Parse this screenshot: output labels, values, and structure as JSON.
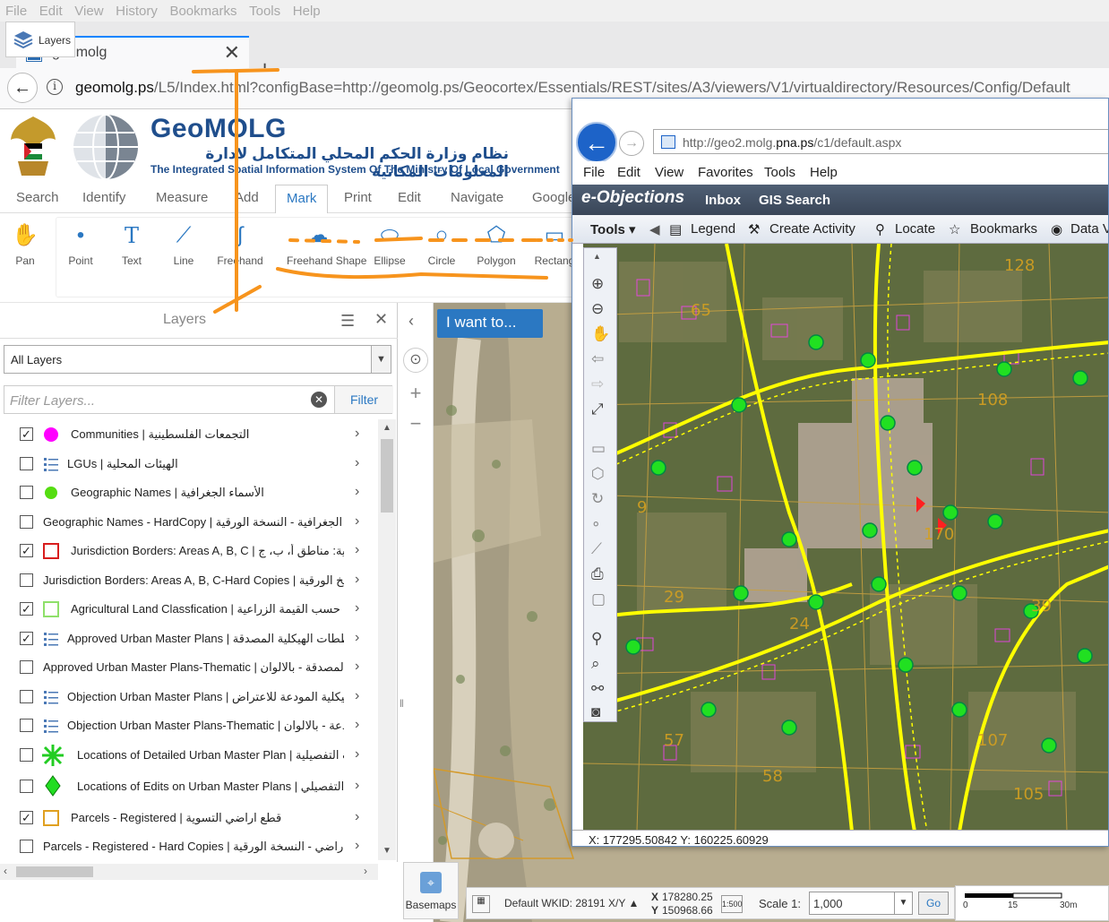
{
  "firefox": {
    "menu": [
      "File",
      "Edit",
      "View",
      "History",
      "Bookmarks",
      "Tools",
      "Help"
    ],
    "tab_title": "geomolg",
    "url_host": "geomolg.ps",
    "url_rest": "/L5/Index.html?configBase=http://geomolg.ps/Geocortex/Essentials/REST/sites/A3/viewers/V1/virtualdirectory/Resources/Config/Default"
  },
  "header": {
    "title": "GeoMOLG",
    "arabic": "نظام وزارة الحكم المحلي المتكامل لادارة المعلومات المكانية",
    "english": "The Integrated Spatial Information System Of The Ministry Of Local Government"
  },
  "menu_tabs": [
    "Search",
    "Identify",
    "Measure",
    "Add",
    "Mark",
    "Print",
    "Edit",
    "Navigate",
    "Google"
  ],
  "active_tab": "Mark",
  "tools": [
    {
      "label": "Pan",
      "icon": "hand-icon",
      "glyph": "✋"
    },
    {
      "label": "Point",
      "icon": "point-icon",
      "glyph": "•"
    },
    {
      "label": "Text",
      "icon": "text-icon",
      "glyph": "T"
    },
    {
      "label": "Line",
      "icon": "line-icon",
      "glyph": "⟋"
    },
    {
      "label": "Freehand",
      "icon": "freehand-icon",
      "glyph": "∫"
    },
    {
      "label": "Freehand Shape",
      "icon": "freehand-shape-icon",
      "glyph": "☁"
    },
    {
      "label": "Ellipse",
      "icon": "ellipse-icon",
      "glyph": "⬭"
    },
    {
      "label": "Circle",
      "icon": "circle-icon",
      "glyph": "○"
    },
    {
      "label": "Polygon",
      "icon": "polygon-icon",
      "glyph": "⬠"
    },
    {
      "label": "Rectang",
      "icon": "rectangle-icon",
      "glyph": "▭"
    }
  ],
  "layers_panel": {
    "title": "Layers",
    "select_value": "All Layers",
    "filter_placeholder": "Filter Layers...",
    "filter_button": "Filter",
    "items": [
      {
        "checked": true,
        "sym": "magenta-dot",
        "text": "Communities | التجمعات الفلسطينية"
      },
      {
        "checked": false,
        "sym": "list",
        "text": "LGUs | الهيئات المحلية"
      },
      {
        "checked": false,
        "sym": "green-dot",
        "text": "Geographic Names | الأسماء الجغرافية"
      },
      {
        "checked": false,
        "sym": "none",
        "text": "Geographic Names - HardCopy | الأسماء الجغرافية - النسخة الورقية"
      },
      {
        "checked": true,
        "sym": "red-square",
        "text": "Jurisdiction Borders: Areas A, B, C | حدود الولاية: مناطق أ، ب، ج"
      },
      {
        "checked": false,
        "sym": "none",
        "text": "Jurisdiction Borders: Areas A, B, C-Hard Copies | النسخ الورقية"
      },
      {
        "checked": true,
        "sym": "green-square",
        "text": "Agricultural Land Classfication | تصنيف الاراضي حسب القيمة الزراعية"
      },
      {
        "checked": true,
        "sym": "list",
        "text": "Approved Urban Master Plans | المخططات الهيكلية المصدقة"
      },
      {
        "checked": false,
        "sym": "none",
        "text": "Approved Urban Master Plans-Thematic | المخططات المصدقة - بالالوان"
      },
      {
        "checked": false,
        "sym": "list",
        "text": "Objection Urban Master Plans | المخططات الهيكلية المودعة للاعتراض"
      },
      {
        "checked": false,
        "sym": "list",
        "text": "Objection Urban Master Plans-Thematic | المودعة - بالالوان"
      },
      {
        "checked": false,
        "sym": "green-star",
        "text": "Locations of Detailed Urban Master Plan | مواقع المخططات التفصيلية"
      },
      {
        "checked": false,
        "sym": "green-diamond",
        "text": "Locations of Edits on Urban Master Plans | مواقع التعديلات التفصيلي"
      },
      {
        "checked": true,
        "sym": "orange-square",
        "text": "Parcels - Registered | قطع اراضي التسوية"
      },
      {
        "checked": false,
        "sym": "none",
        "text": "Parcels - Registered - Hard Copies | قطع اراضي - النسخة الورقية"
      }
    ]
  },
  "map": {
    "i_want_to": "I want to...",
    "basemaps": "Basemaps",
    "wkid": "Default WKID: 28191 X/Y ▲",
    "x": "178280.25",
    "y": "150968.66",
    "x_label": "X",
    "y_label": "Y",
    "scale_label": "Scale 1:",
    "scale_value": "1,000",
    "go": "Go",
    "scale_ticks": [
      "0",
      "15",
      "30m"
    ]
  },
  "bottom": {
    "layers_tab": "Layers"
  },
  "ie": {
    "url_host": "http://geo2.molg.",
    "url_mid": "pna.ps",
    "url_rest": "/c1/default.aspx",
    "menu": [
      "File",
      "Edit",
      "View",
      "Favorites",
      "Tools",
      "Help"
    ],
    "app_title": "e-Objections",
    "inbox": "Inbox",
    "gis": "GIS Search",
    "toolbar": [
      "Tools ▾",
      "Legend",
      "Create Activity",
      "Locate",
      "Bookmarks",
      "Data V"
    ],
    "status": "X: 177295.50842  Y: 160225.60929"
  }
}
